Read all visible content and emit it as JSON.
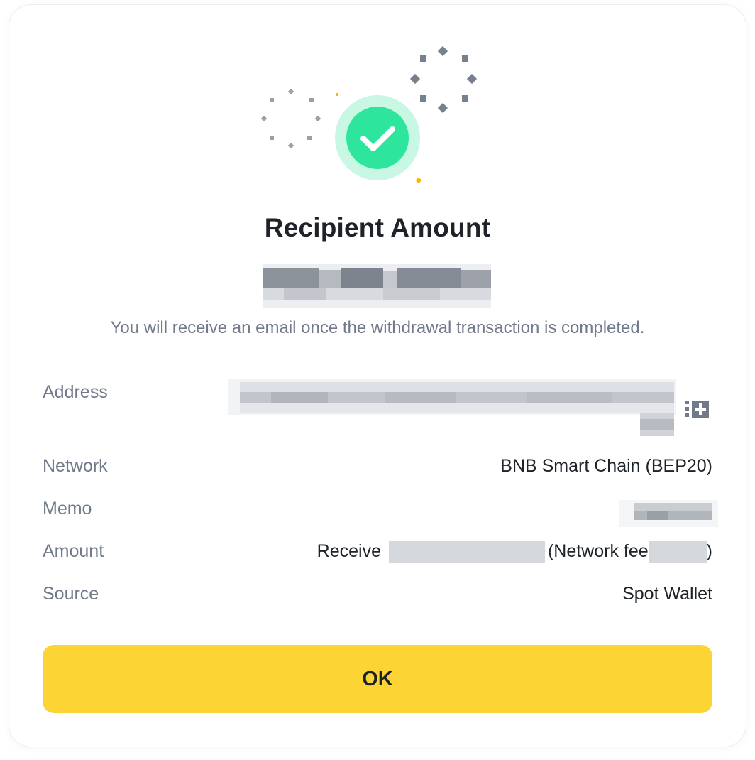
{
  "dialog": {
    "title": "Recipient Amount",
    "email_note": "You will receive an email once the withdrawal transaction is completed."
  },
  "details": {
    "address_label": "Address",
    "network_label": "Network",
    "network_value": "BNB Smart Chain (BEP20)",
    "memo_label": "Memo",
    "amount_label": "Amount",
    "amount_receive_prefix": "Receive",
    "amount_fee_prefix": "(Network fee",
    "amount_fee_suffix": ")",
    "source_label": "Source",
    "source_value": "Spot Wallet"
  },
  "actions": {
    "ok_label": "OK"
  },
  "colors": {
    "accent_yellow": "#fcd535",
    "success_green": "#2ee59d",
    "success_ring": "#c8f7e3",
    "text_primary": "#1e2329",
    "text_secondary": "#707a8a"
  },
  "icons": {
    "success": "check-circle-icon",
    "copy": "copy-icon"
  }
}
